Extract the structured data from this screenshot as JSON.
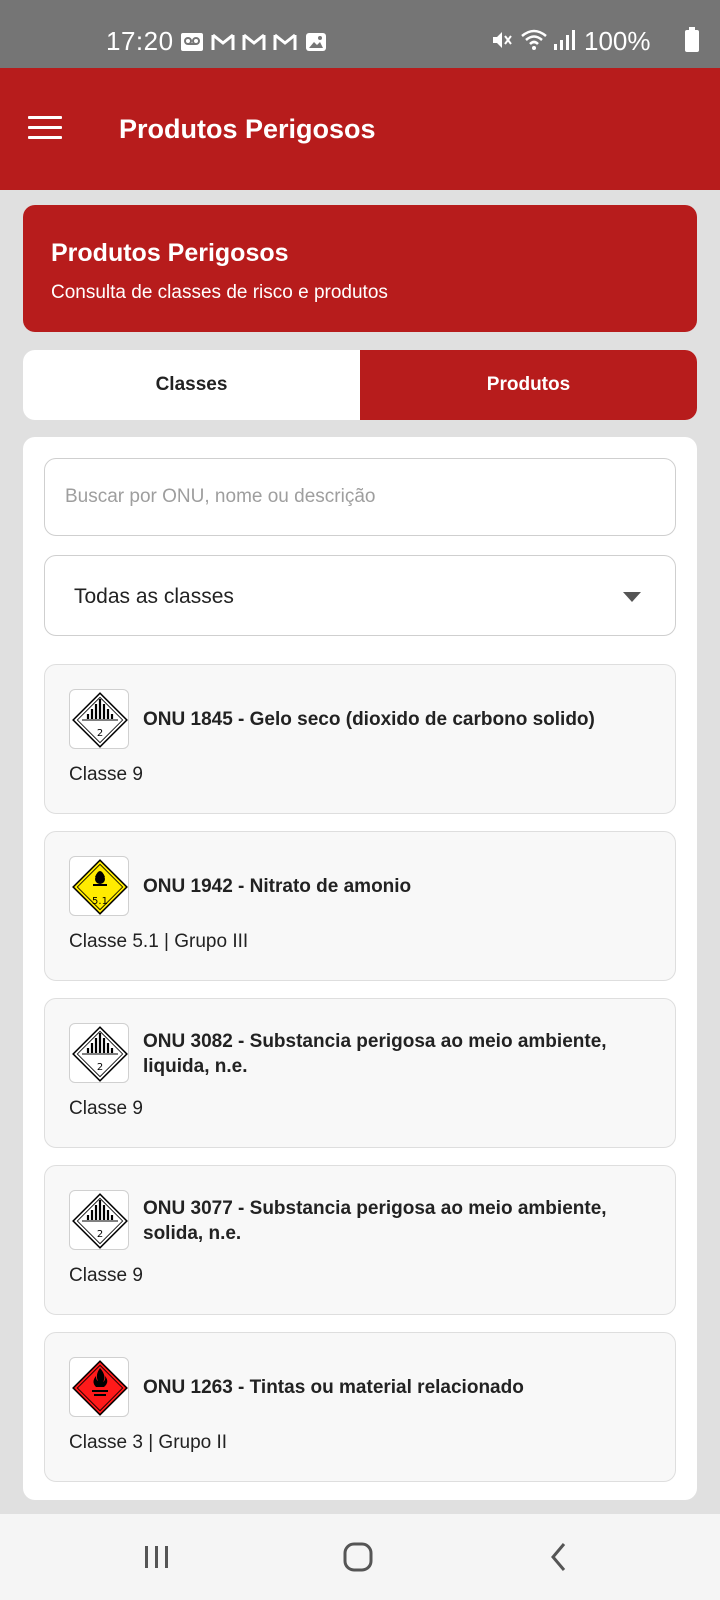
{
  "status_bar": {
    "time": "17:20",
    "battery": "100%",
    "icons": [
      "voicemail-icon",
      "gmail-icon",
      "gmail-icon",
      "gmail-icon",
      "gallery-icon",
      "mute-icon",
      "wifi-icon",
      "signal-icon",
      "battery-icon"
    ]
  },
  "app_bar": {
    "title": "Produtos Perigosos",
    "menu_icon": "hamburger-menu-icon"
  },
  "header_card": {
    "title": "Produtos Perigosos",
    "subtitle": "Consulta de classes de risco e produtos"
  },
  "tabs": [
    {
      "label": "Classes",
      "active": false
    },
    {
      "label": "Produtos",
      "active": true
    }
  ],
  "search": {
    "placeholder": "Buscar por ONU, nome ou descrição",
    "value": ""
  },
  "class_filter": {
    "selected": "Todas as classes"
  },
  "products": [
    {
      "title": "ONU 1845 - Gelo seco (dioxido de carbono solido)",
      "meta": "Classe 9",
      "icon": "class-9-placard-icon"
    },
    {
      "title": "ONU 1942 - Nitrato de amonio",
      "meta": "Classe 5.1 | Grupo III",
      "icon": "class-5-1-oxidizer-placard-icon"
    },
    {
      "title": "ONU 3082 - Substancia perigosa ao meio ambiente, liquida, n.e.",
      "meta": "Classe 9",
      "icon": "class-9-placard-icon"
    },
    {
      "title": "ONU 3077 - Substancia perigosa ao meio ambiente, solida, n.e.",
      "meta": "Classe 9",
      "icon": "class-9-placard-icon"
    },
    {
      "title": "ONU 1263 - Tintas ou material relacionado",
      "meta": "Classe 3 | Grupo II",
      "icon": "class-3-flammable-placard-icon"
    }
  ],
  "colors": {
    "primary": "#b71c1c",
    "status_bar": "#757575",
    "background": "#e0e0e0",
    "oxidizer": "#ffeb00",
    "flammable": "#ff1a1a"
  },
  "nav_bar": {
    "icons": [
      "recent-apps-icon",
      "home-icon",
      "back-icon"
    ]
  }
}
